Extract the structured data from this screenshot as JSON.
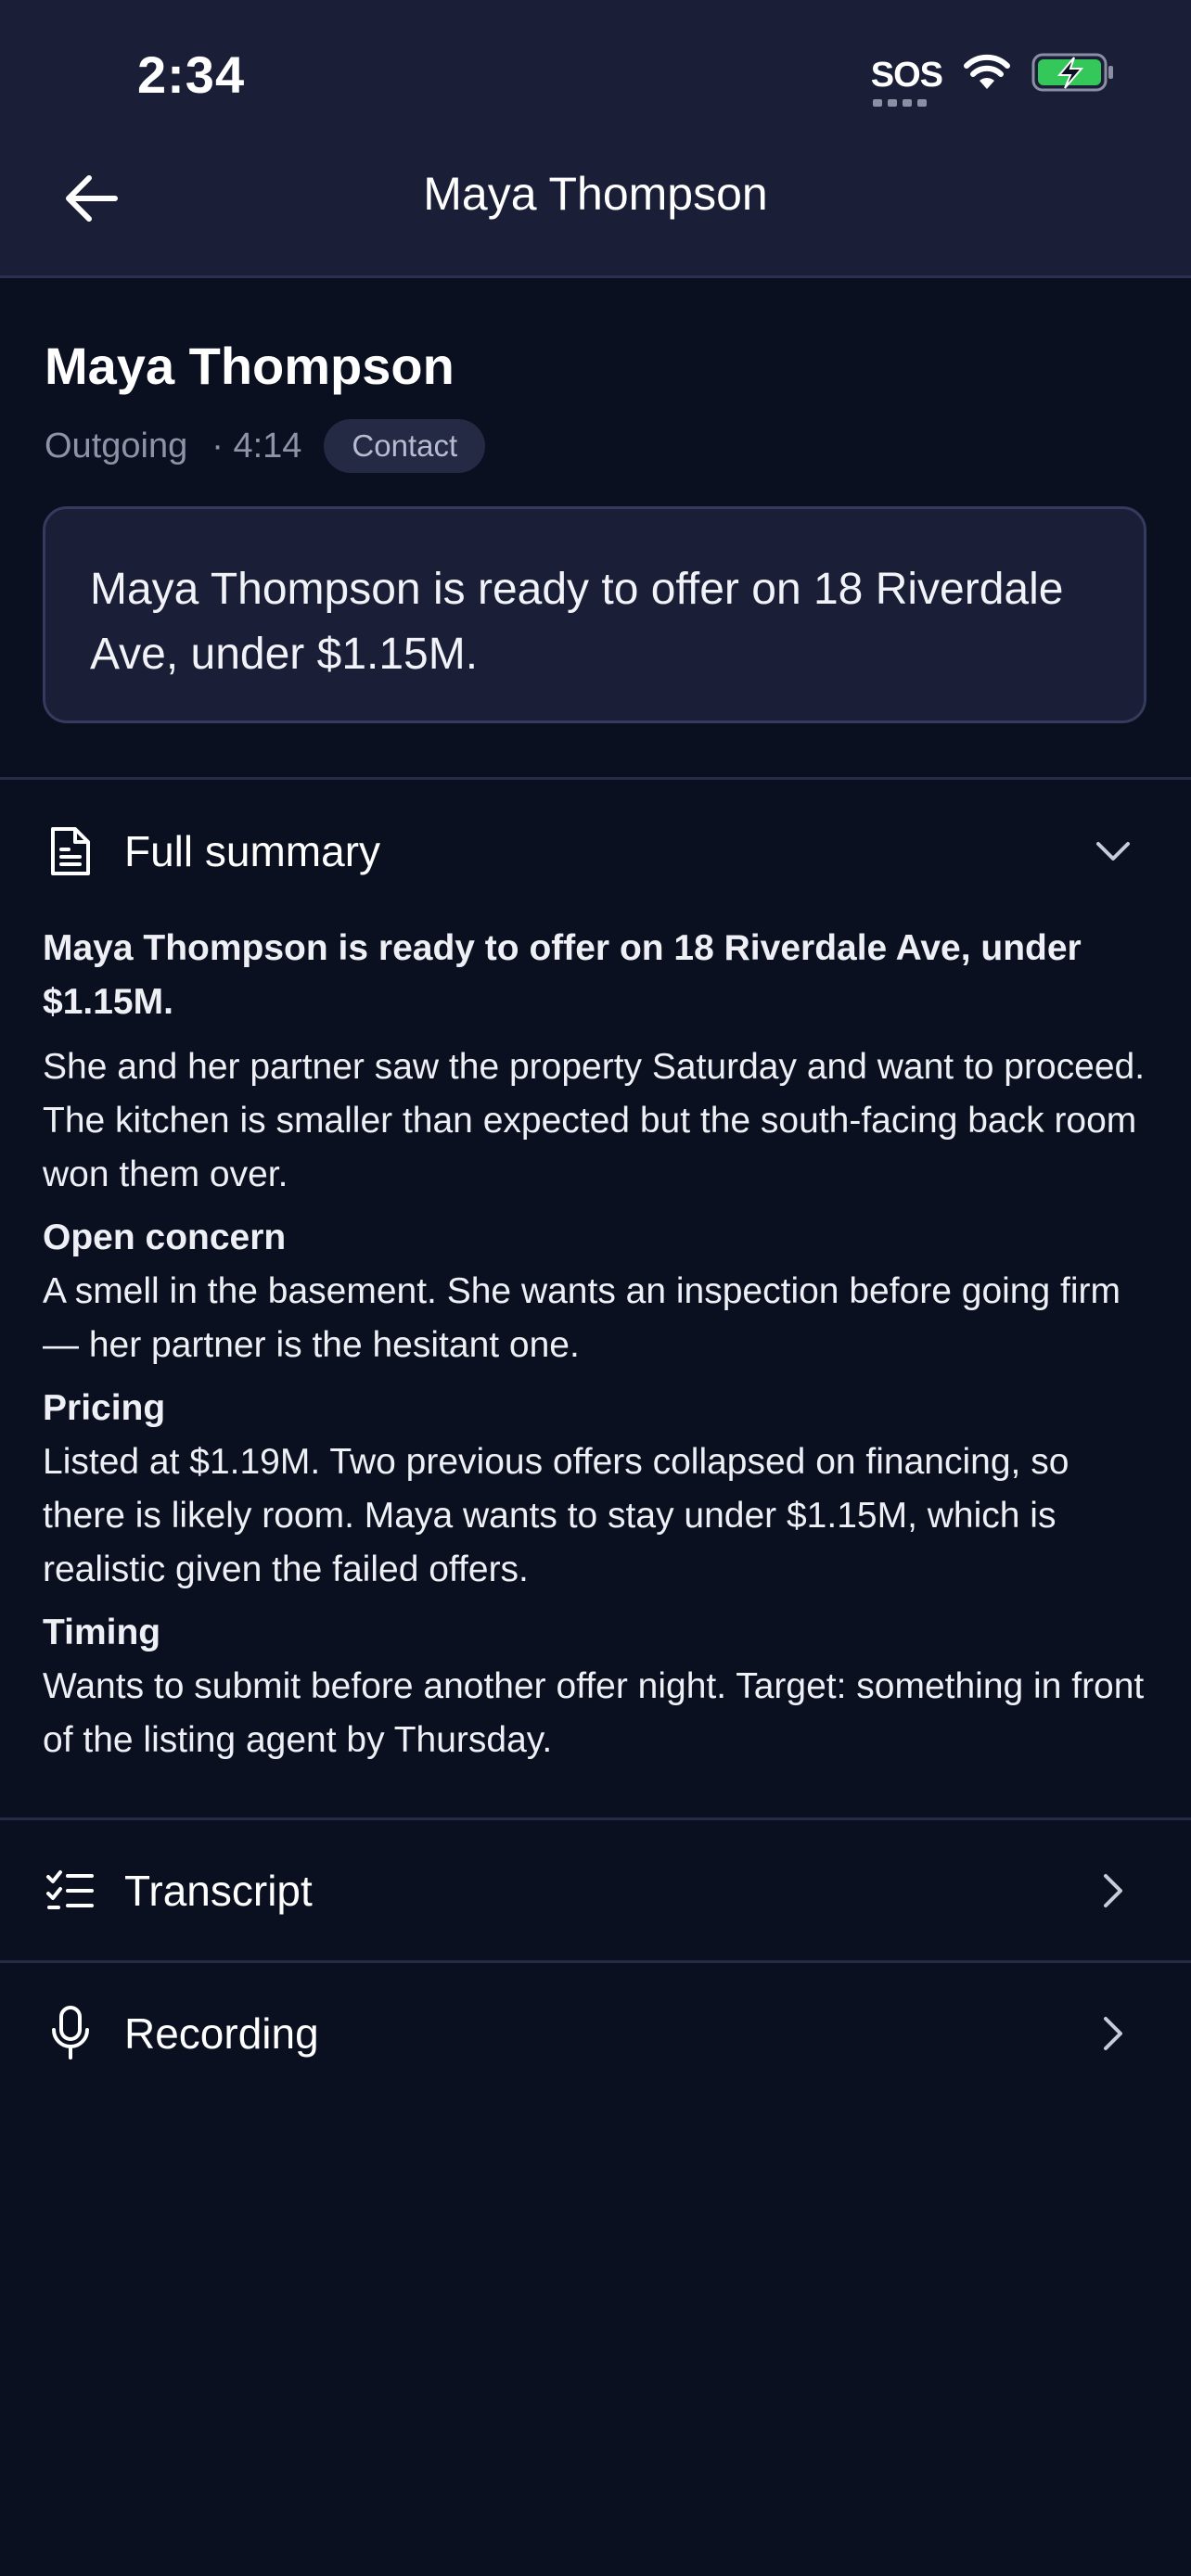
{
  "status_bar": {
    "time": "2:34",
    "sos": "SOS"
  },
  "nav": {
    "title": "Maya Thompson",
    "back_icon": "arrow-left-icon"
  },
  "call": {
    "name": "Maya Thompson",
    "direction": "Outgoing",
    "duration": "· 4:14",
    "contact_chip": "Contact",
    "summary_card": "Maya Thompson is ready to offer on 18 Riverdale Ave, under $1.15M."
  },
  "full_summary": {
    "label": "Full summary",
    "headline": "Maya Thompson is ready to offer on 18 Riverdale Ave, under $1.15M.",
    "intro": "She and her partner saw the property Saturday and want to proceed. The kitchen is smaller than expected but the south-facing back room won them over.",
    "sections": [
      {
        "title": "Open concern",
        "text": "A smell in the basement. She wants an inspection before going firm — her partner is the hesitant one."
      },
      {
        "title": "Pricing",
        "text": "Listed at $1.19M. Two previous offers collapsed on financing, so there is likely room. Maya wants to stay under $1.15M, which is realistic given the failed offers."
      },
      {
        "title": "Timing",
        "text": "Wants to submit before another offer night. Target: something in front of the listing agent by Thursday."
      }
    ]
  },
  "rows": {
    "transcript": "Transcript",
    "recording": "Recording"
  },
  "colors": {
    "background": "#0b1020",
    "header": "#1a1e36",
    "card_border": "#353b5e",
    "battery_green": "#34c759"
  }
}
